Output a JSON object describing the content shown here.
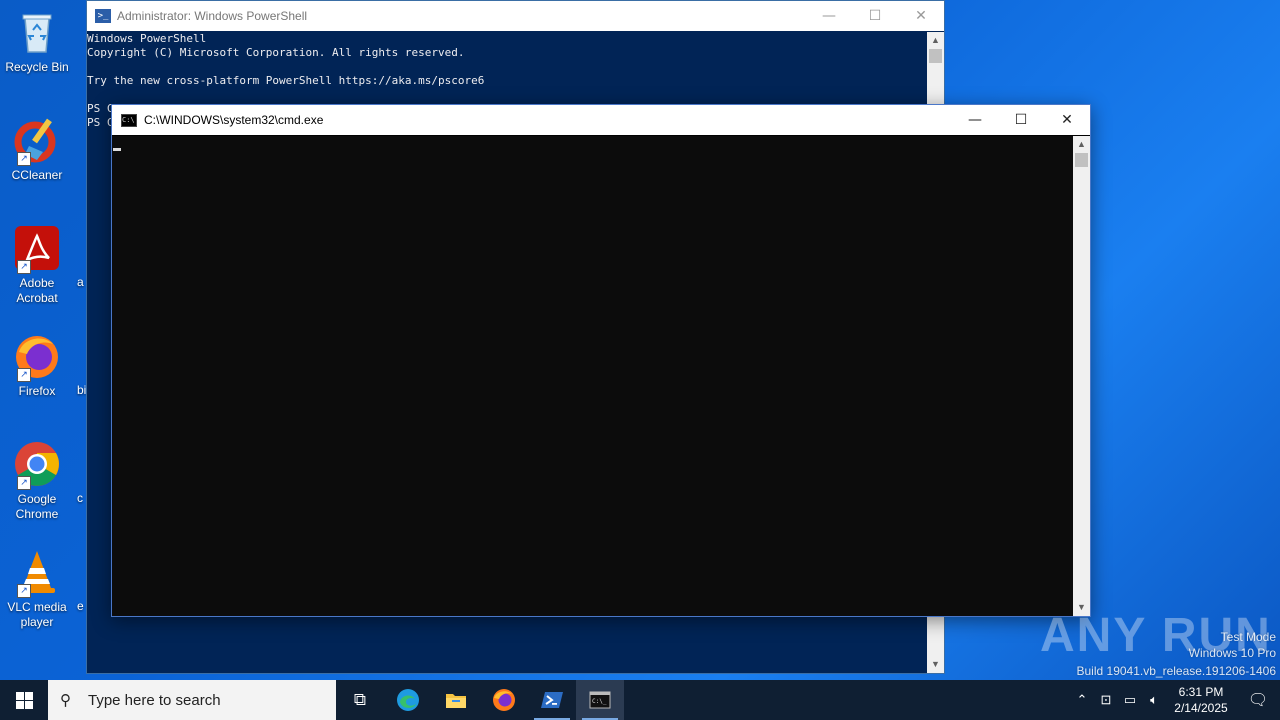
{
  "desktop": {
    "icons": [
      {
        "label": "Recycle Bin"
      },
      {
        "label": "CCleaner"
      },
      {
        "label": "Adobe Acrobat"
      },
      {
        "label": "Firefox"
      },
      {
        "label": "Google Chrome"
      },
      {
        "label": "VLC media player"
      }
    ],
    "behind_labels": [
      "a",
      "bi",
      "c",
      "e"
    ]
  },
  "powershell": {
    "title": "Administrator: Windows PowerShell",
    "lines": [
      "Windows PowerShell",
      "Copyright (C) Microsoft Corporation. All rights reserved.",
      "",
      "Try the new cross-platform PowerShell https://aka.ms/pscore6",
      "",
      "PS C",
      "PS C"
    ]
  },
  "cmd": {
    "title": "C:\\WINDOWS\\system32\\cmd.exe",
    "content": ""
  },
  "window_controls": {
    "minimize": "—",
    "maximize": "☐",
    "close": "✕"
  },
  "watermark": {
    "brand": "ANY RUN",
    "line1": "Test Mode",
    "line2": "Windows 10 Pro",
    "line3": "Build 19041.vb_release.191206-1406"
  },
  "taskbar": {
    "search_placeholder": "Type here to search",
    "apps": [
      {
        "icon": "task-view-icon"
      },
      {
        "icon": "edge-icon"
      },
      {
        "icon": "file-explorer-icon"
      },
      {
        "icon": "firefox-icon"
      },
      {
        "icon": "powershell-icon"
      },
      {
        "icon": "cmd-icon"
      }
    ],
    "clock_time": "6:31 PM",
    "clock_date": "2/14/2025"
  }
}
